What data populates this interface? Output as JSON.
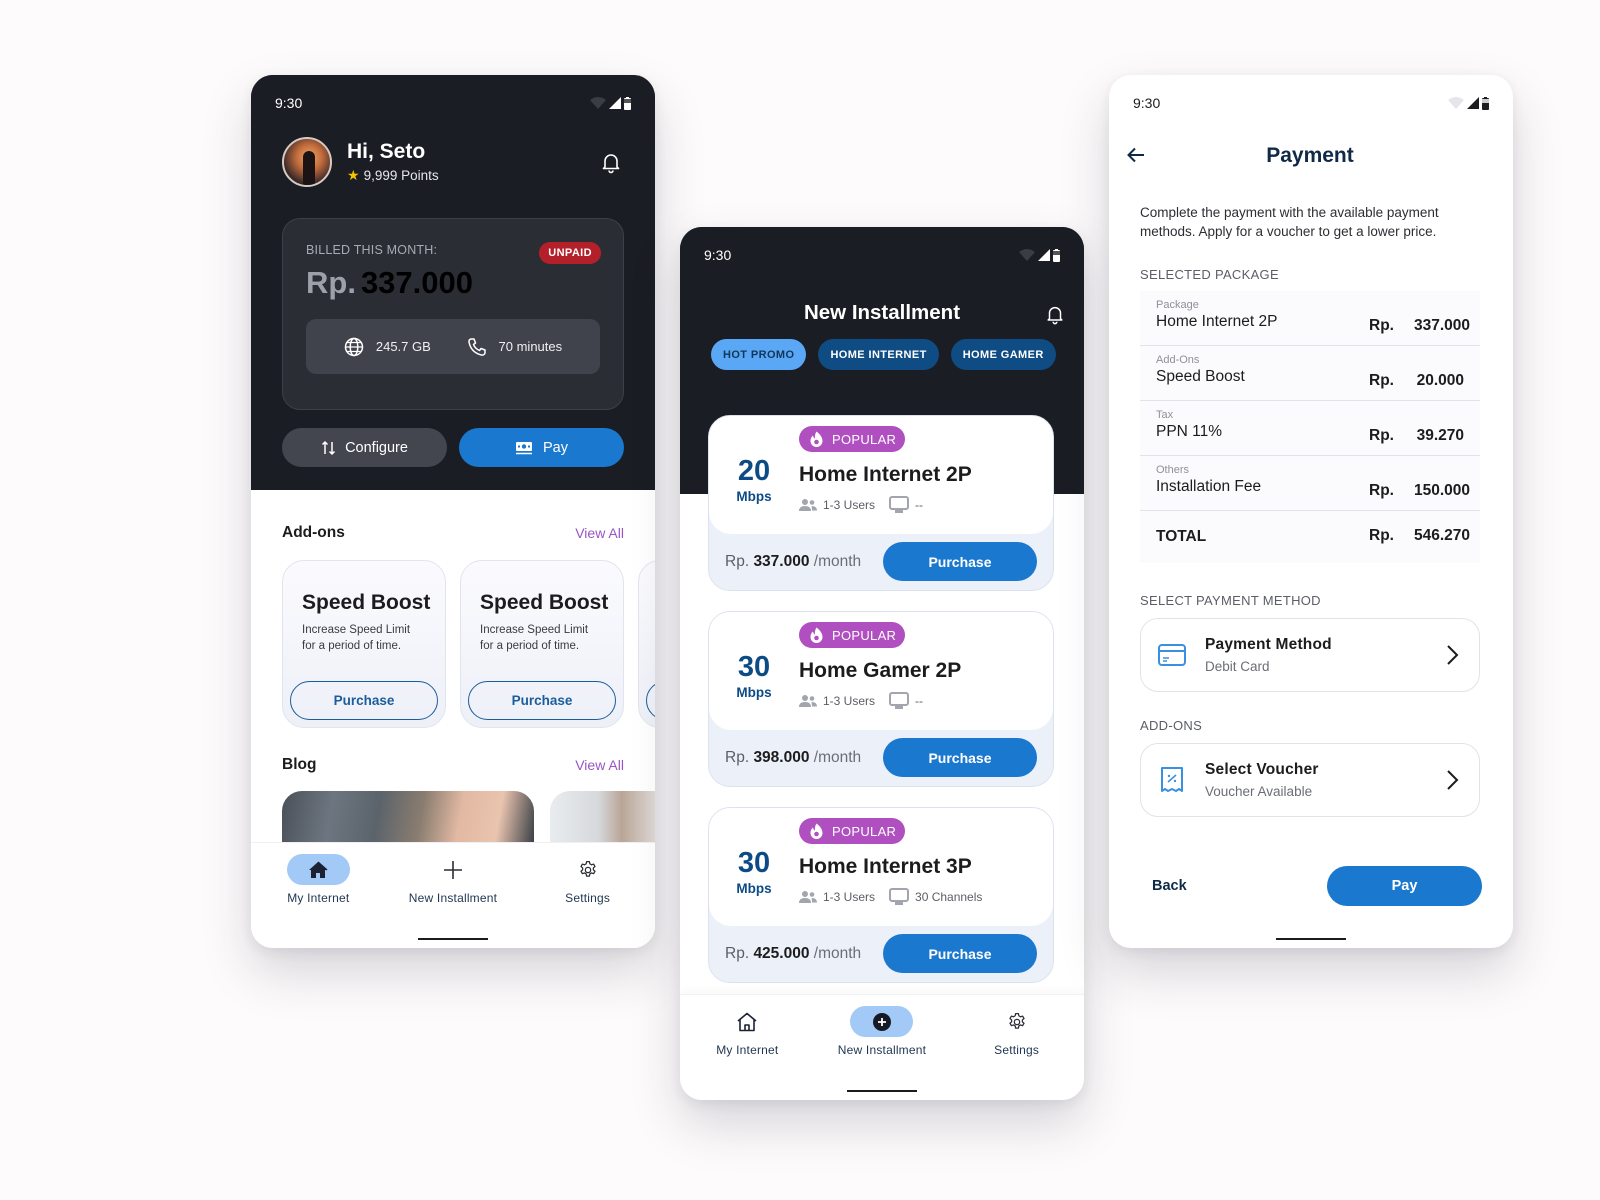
{
  "status_bar": {
    "time": "9:30"
  },
  "home": {
    "greeting": "Hi, Seto",
    "points": "9,999 Points",
    "bill": {
      "label": "BILLED THIS MONTH:",
      "status_badge": "UNPAID",
      "currency": "Rp.",
      "amount": "337.000",
      "data_usage": "245.7 GB",
      "call_usage": "70 minutes"
    },
    "actions": {
      "configure": "Configure",
      "pay": "Pay"
    },
    "addons": {
      "title": "Add-ons",
      "view_all": "View All",
      "items": [
        {
          "title": "Speed Boost",
          "desc_line1": "Increase Speed Limit",
          "desc_line2": "for a period of time.",
          "button": "Purchase"
        },
        {
          "title": "Speed Boost",
          "desc_line1": "Increase Speed Limit",
          "desc_line2": "for a period of time.",
          "button": "Purchase"
        }
      ]
    },
    "blog": {
      "title": "Blog",
      "view_all": "View All"
    },
    "nav": [
      {
        "label": "My Internet",
        "icon": "home-icon",
        "active": true
      },
      {
        "label": "New Installment",
        "icon": "plus-icon",
        "active": false
      },
      {
        "label": "Settings",
        "icon": "gear-icon",
        "active": false
      }
    ]
  },
  "installment": {
    "title": "New Installment",
    "chips": [
      {
        "label": "HOT PROMO",
        "active": true
      },
      {
        "label": "HOME INTERNET",
        "active": false
      },
      {
        "label": "HOME GAMER",
        "active": false
      }
    ],
    "plans": [
      {
        "badge": "POPULAR",
        "speed": "20",
        "unit": "Mbps",
        "name": "Home Internet 2P",
        "users": "1-3 Users",
        "channels": "--",
        "currency": "Rp.",
        "price": "337.000",
        "period": "/month",
        "button": "Purchase"
      },
      {
        "badge": "POPULAR",
        "speed": "30",
        "unit": "Mbps",
        "name": "Home Gamer 2P",
        "users": "1-3 Users",
        "channels": "--",
        "currency": "Rp.",
        "price": "398.000",
        "period": "/month",
        "button": "Purchase"
      },
      {
        "badge": "POPULAR",
        "speed": "30",
        "unit": "Mbps",
        "name": "Home Internet 3P",
        "users": "1-3 Users",
        "channels": "30 Channels",
        "currency": "Rp.",
        "price": "425.000",
        "period": "/month",
        "button": "Purchase"
      }
    ],
    "nav": [
      {
        "label": "My Internet",
        "icon": "home-icon",
        "active": false
      },
      {
        "label": "New Installment",
        "icon": "plus-circle-icon",
        "active": true
      },
      {
        "label": "Settings",
        "icon": "gear-icon",
        "active": false
      }
    ]
  },
  "payment": {
    "title": "Payment",
    "description": "Complete the payment with the available payment methods. Apply for a voucher to get a lower price.",
    "selected_package_label": "SELECTED PACKAGE",
    "summary": [
      {
        "category": "Package",
        "name": "Home Internet 2P",
        "currency": "Rp.",
        "amount": "337.000"
      },
      {
        "category": "Add-Ons",
        "name": "Speed Boost",
        "currency": "Rp.",
        "amount": "20.000"
      },
      {
        "category": "Tax",
        "name": "PPN 11%",
        "currency": "Rp.",
        "amount": "39.270"
      },
      {
        "category": "Others",
        "name": "Installation Fee",
        "currency": "Rp.",
        "amount": "150.000"
      }
    ],
    "total": {
      "label": "TOTAL",
      "currency": "Rp.",
      "amount": "546.270"
    },
    "payment_method_label": "SELECT PAYMENT METHOD",
    "payment_method": {
      "title": "Payment Method",
      "value": "Debit Card"
    },
    "addons_label": "ADD-ONS",
    "voucher": {
      "title": "Select Voucher",
      "value": "Voucher Available"
    },
    "back_label": "Back",
    "pay_label": "Pay"
  }
}
